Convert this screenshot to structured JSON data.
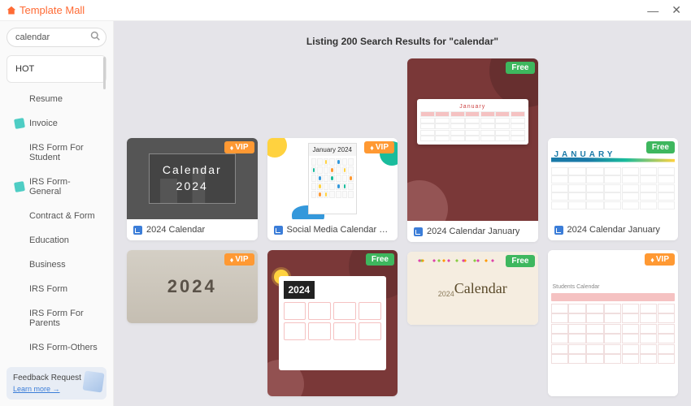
{
  "app": {
    "title": "Template Mall"
  },
  "window": {
    "minimize": "—",
    "close": "✕"
  },
  "search": {
    "value": "calendar"
  },
  "sidebar": {
    "items": [
      {
        "label": "HOT",
        "hot": true
      },
      {
        "label": "Resume"
      },
      {
        "label": "Invoice",
        "pin": true
      },
      {
        "label": "IRS Form For Student"
      },
      {
        "label": "IRS Form-General",
        "pin": true
      },
      {
        "label": "Contract & Form"
      },
      {
        "label": "Education"
      },
      {
        "label": "Business"
      },
      {
        "label": "IRS Form"
      },
      {
        "label": "IRS Form For Parents"
      },
      {
        "label": "IRS Form-Others"
      }
    ]
  },
  "feedback": {
    "title": "Feedback Request",
    "link": "Learn more"
  },
  "results": {
    "heading": "Listing 200 Search Results for \"calendar\"",
    "cards": [
      {
        "title": "2024 Calendar",
        "badge": "VIP",
        "thumb_line1": "Calendar",
        "thumb_line2": "2024"
      },
      {
        "title": "Social Media Calendar 202...",
        "badge": "VIP",
        "thumb_hdr": "January 2024"
      },
      {
        "title": "2024 Calendar January",
        "badge": "Free",
        "thumb_month": "January"
      },
      {
        "title": "2024 Calendar January",
        "badge": "Free",
        "thumb_jan": "JANUARY"
      },
      {
        "title": "",
        "badge": "VIP",
        "thumb_year": "2024"
      },
      {
        "title": "",
        "badge": "Free",
        "thumb_year": "2024"
      },
      {
        "title": "",
        "badge": "Free",
        "thumb_year": "2024",
        "thumb_word": "Calendar"
      },
      {
        "title": "",
        "badge": "VIP",
        "thumb_students": "Students Calendar"
      }
    ]
  }
}
